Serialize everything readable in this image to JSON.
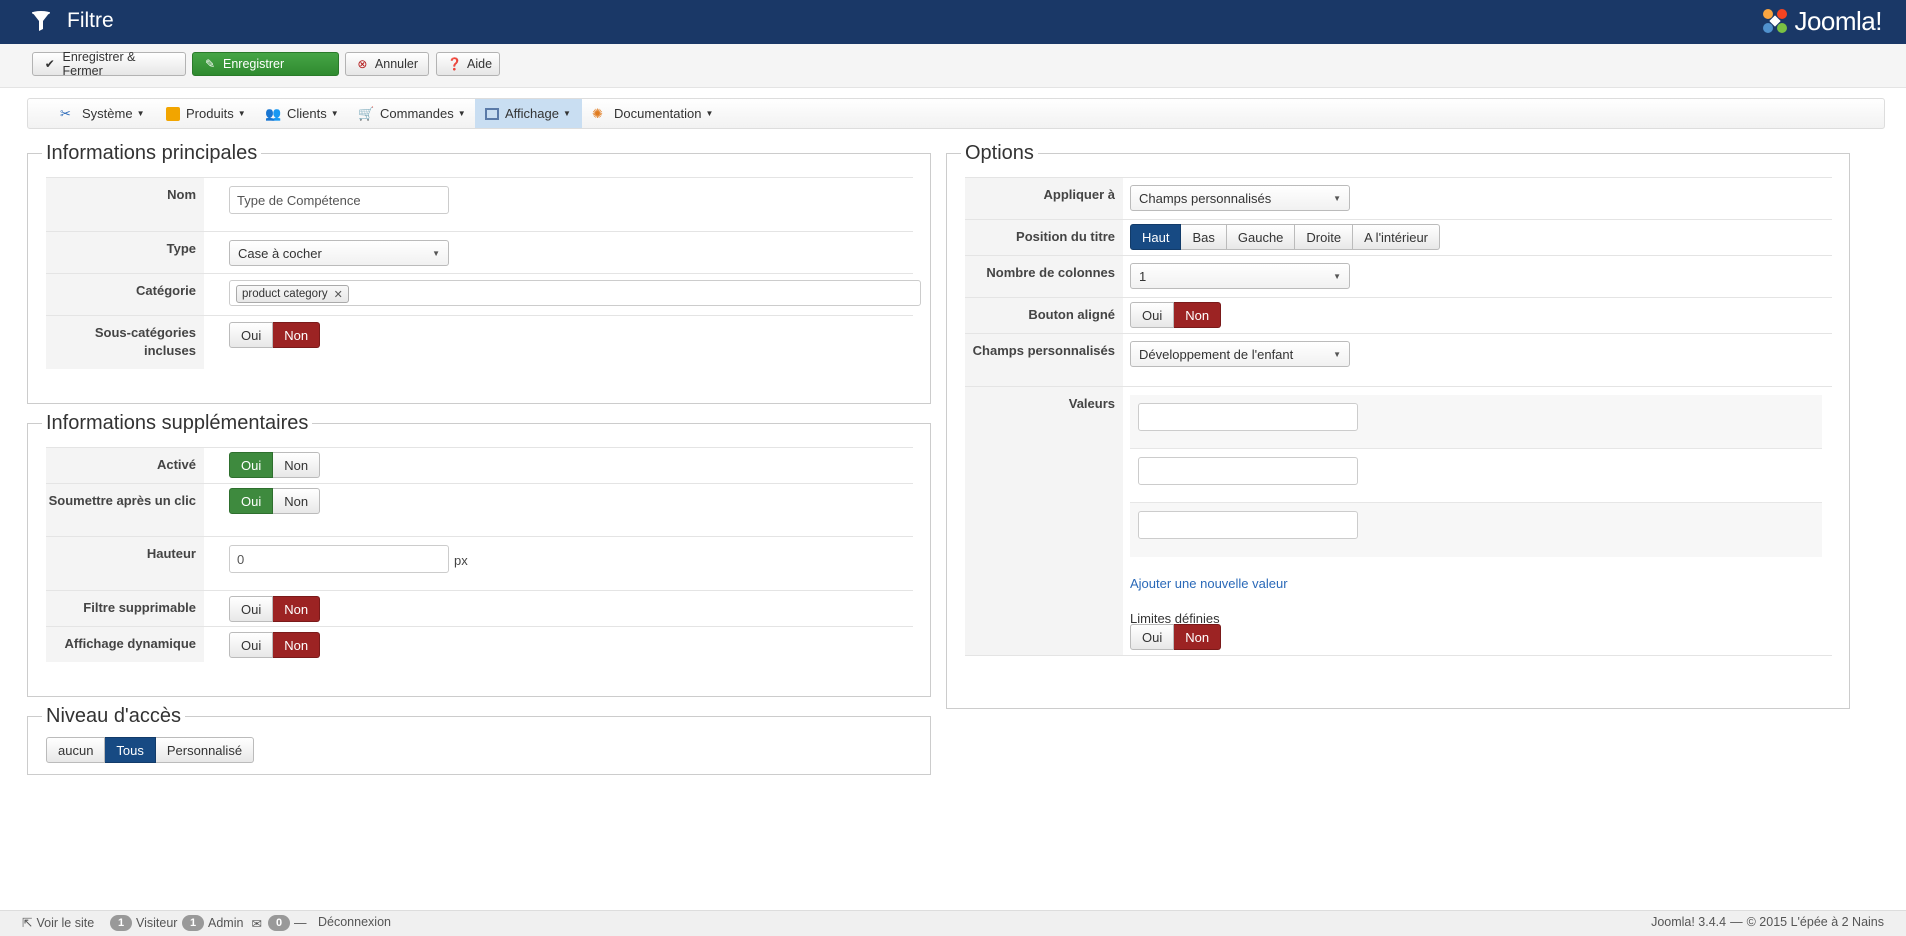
{
  "header": {
    "title": "Filtre",
    "logo_text": "Joomla!"
  },
  "toolbar": {
    "save_close": "Enregistrer & Fermer",
    "save": "Enregistrer",
    "cancel": "Annuler",
    "help": "Aide"
  },
  "nav": {
    "items": [
      {
        "label": "Système",
        "icon": "tools-icon"
      },
      {
        "label": "Produits",
        "icon": "box-icon"
      },
      {
        "label": "Clients",
        "icon": "users-icon"
      },
      {
        "label": "Commandes",
        "icon": "cart-icon"
      },
      {
        "label": "Affichage",
        "icon": "display-icon",
        "active": true
      },
      {
        "label": "Documentation",
        "icon": "help-ring-icon"
      }
    ]
  },
  "main_info": {
    "legend": "Informations principales",
    "nom_label": "Nom",
    "nom_value": "Type de Compétence",
    "type_label": "Type",
    "type_value": "Case à cocher",
    "categorie_label": "Catégorie",
    "categorie_tag": "product category",
    "subcat_label": "Sous-catégories incluses",
    "subcat_yes": "Oui",
    "subcat_no": "Non"
  },
  "extra_info": {
    "legend": "Informations supplémentaires",
    "active_label": "Activé",
    "submit_label": "Soumettre après un clic",
    "height_label": "Hauteur",
    "height_value": "0",
    "height_unit": "px",
    "deletable_label": "Filtre supprimable",
    "dynamic_label": "Affichage dynamique",
    "yes": "Oui",
    "no": "Non"
  },
  "access": {
    "legend": "Niveau d'accès",
    "options": [
      "aucun",
      "Tous",
      "Personnalisé"
    ],
    "selected": "Tous"
  },
  "options": {
    "legend": "Options",
    "apply_label": "Appliquer à",
    "apply_value": "Champs personnalisés",
    "title_pos_label": "Position du titre",
    "title_pos_options": [
      "Haut",
      "Bas",
      "Gauche",
      "Droite",
      "A l'intérieur"
    ],
    "title_pos_selected": "Haut",
    "columns_label": "Nombre de colonnes",
    "columns_value": "1",
    "aligned_label": "Bouton aligné",
    "custom_fields_label": "Champs personnalisés",
    "custom_fields_value": "Développement de l'enfant",
    "values_label": "Valeurs",
    "add_value_link": "Ajouter une nouvelle valeur",
    "limits_label": "Limites définies",
    "yes": "Oui",
    "no": "Non"
  },
  "footer": {
    "view_site": "Voir le site",
    "visitor_count": "1",
    "visitor_label": "Visiteur",
    "admin_count": "1",
    "admin_label": "Admin",
    "messages_count": "0",
    "logout": "Déconnexion",
    "version": "Joomla! 3.4.4",
    "copyright": "© 2015 L'épée à 2 Nains"
  },
  "colors": {
    "header_bg": "#1a3867",
    "green": "#3e8a3e",
    "red": "#9c2323",
    "blue": "#174a83",
    "link": "#2a69b8"
  }
}
